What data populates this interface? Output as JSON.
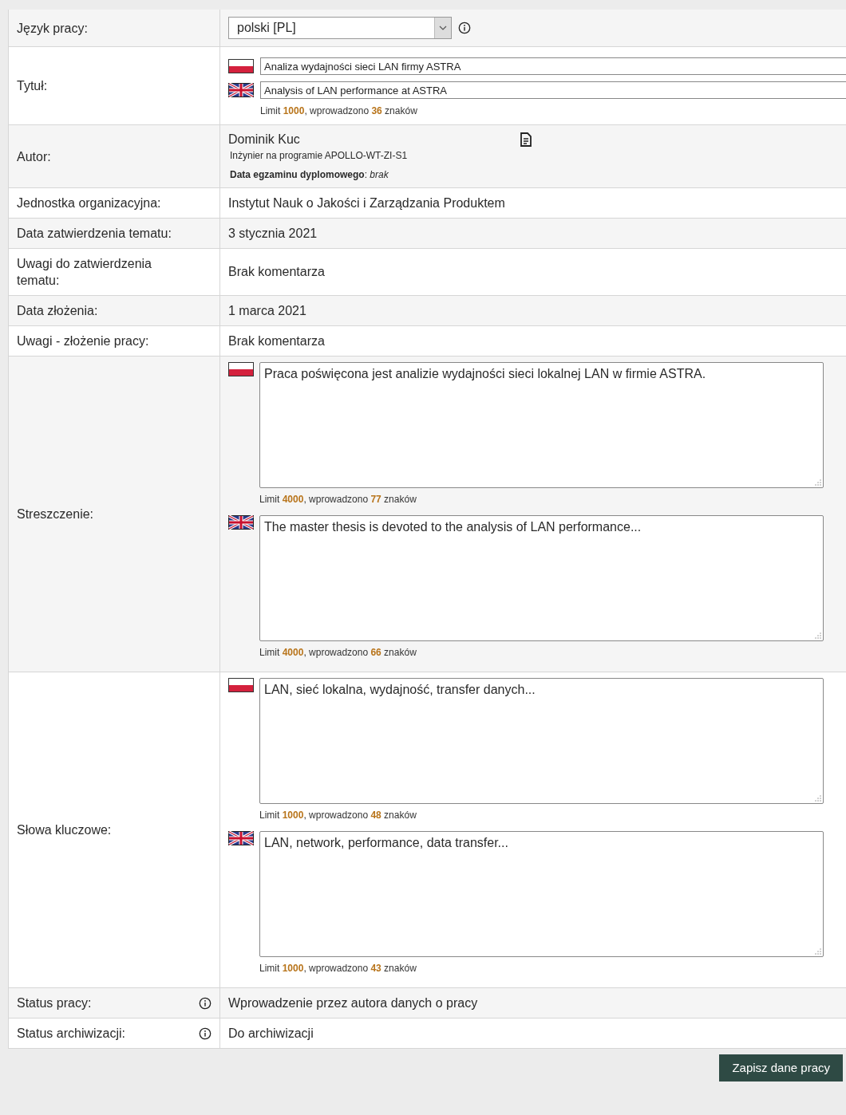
{
  "rows": [
    {
      "kind": "select",
      "label": "Język pracy:",
      "value": "polski [PL]",
      "info": true
    },
    {
      "kind": "inputs",
      "label": "Tytuł:",
      "fields": [
        {
          "kind": "pl",
          "value": "Analiza wydajności sieci LAN firmy ASTRA"
        },
        {
          "kind": "en",
          "value": "Analysis of LAN performance at ASTRA"
        }
      ],
      "counters": [
        "Limit **1000**, wprowadzono **36** znaków"
      ]
    },
    {
      "kind": "author",
      "label": "Autor:",
      "name": "Dominik Kuc",
      "program": "Inżynier na programie APOLLO-WT-ZI-S1",
      "exam": "**Data egzaminu dyplomowego**: *brak*"
    },
    {
      "kind": "text",
      "label": "Jednostka organizacyjna:",
      "value": "Instytut Nauk o Jakości i Zarządzania Produktem"
    },
    {
      "kind": "text",
      "label": "Data zatwierdzenia tematu:",
      "value": "3 stycznia 2021"
    },
    {
      "kind": "text",
      "label": "Uwagi do zatwierdzenia tematu:",
      "value": "Brak komentarza"
    },
    {
      "kind": "text",
      "label": "Data złożenia:",
      "value": "1 marca 2021"
    },
    {
      "kind": "text",
      "label": "Uwagi - złożenie pracy:",
      "value": "Brak komentarza"
    },
    {
      "kind": "textareas",
      "label": "Streszczenie:",
      "fields": [
        {
          "kind": "pl",
          "value": "Praca poświęcona jest analizie wydajności sieci lokalnej LAN w firmie ASTRA.",
          "counter": "Limit **4000**, wprowadzono **77** znaków"
        },
        {
          "kind": "en",
          "value": "The master thesis is devoted to the analysis of LAN performance...",
          "counter": "Limit **4000**, wprowadzono **66** znaków"
        }
      ]
    },
    {
      "kind": "textareas",
      "label": "Słowa kluczowe:",
      "fields": [
        {
          "kind": "pl",
          "value": "LAN, sieć lokalna, wydajność, transfer danych...",
          "counter": "Limit **1000**, wprowadzono **48** znaków"
        },
        {
          "kind": "en",
          "value": "LAN, network, performance, data transfer...",
          "counter": "Limit **1000**, wprowadzono **43** znaków"
        }
      ]
    },
    {
      "kind": "text",
      "label": "Status pracy:",
      "value": "Wprowadzenie przez autora danych o pracy",
      "info": true
    },
    {
      "kind": "text",
      "label": "Status archiwizacji:",
      "value": "Do archiwizacji",
      "info": true
    }
  ],
  "save_button": "Zapisz dane pracy"
}
